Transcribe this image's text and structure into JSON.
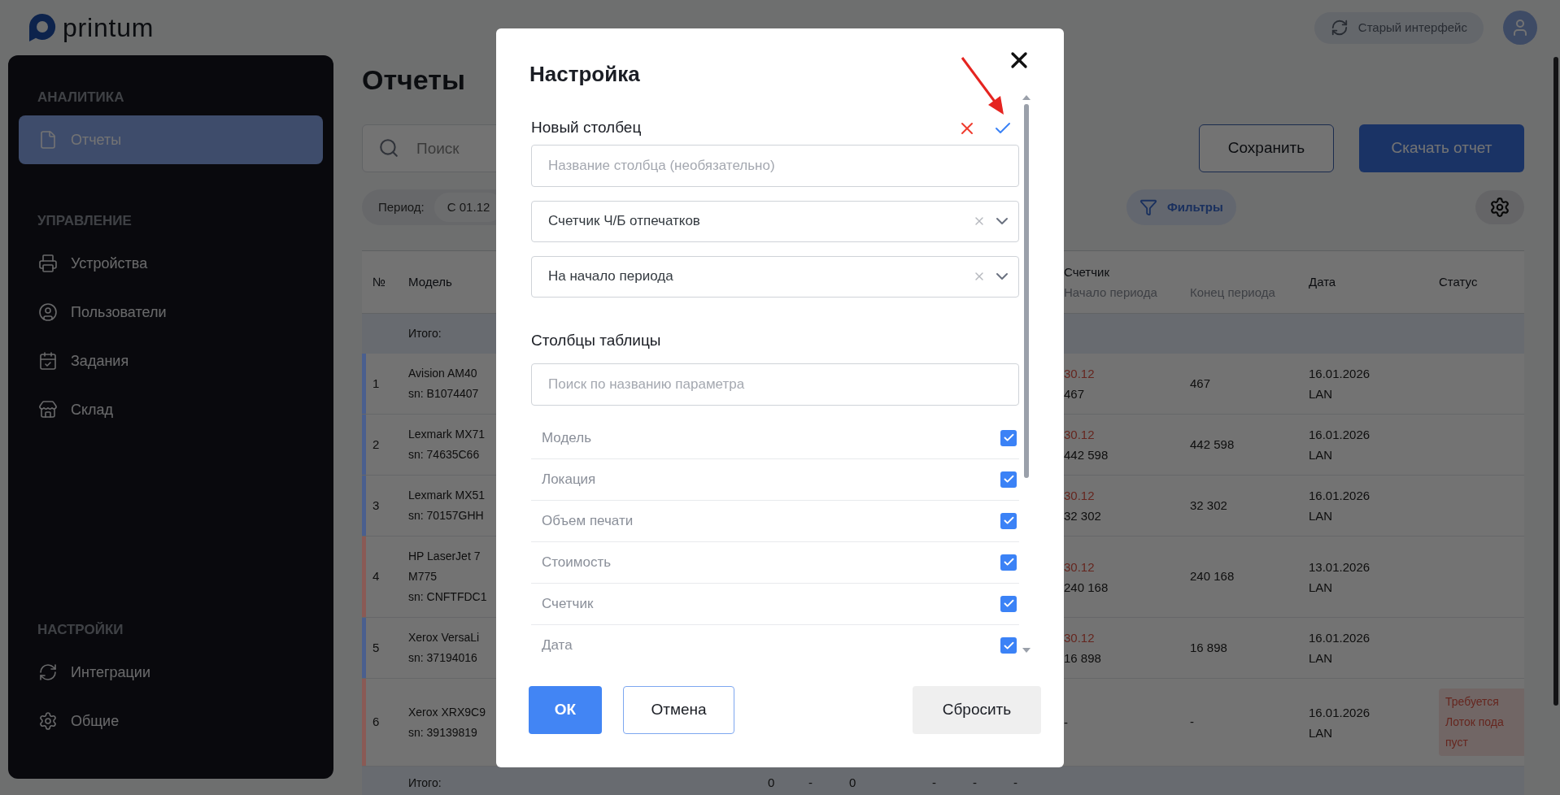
{
  "header": {
    "logo_text": "printum",
    "old_ui_button": "Старый интерфейс"
  },
  "sidebar": {
    "sections": [
      {
        "title": "АНАЛИТИКА",
        "items": [
          {
            "label": "Отчеты",
            "selected": true
          }
        ]
      },
      {
        "title": "УПРАВЛЕНИЕ",
        "items": [
          {
            "label": "Устройства",
            "selected": false
          },
          {
            "label": "Пользователи",
            "selected": false
          },
          {
            "label": "Задания",
            "selected": false
          },
          {
            "label": "Склад",
            "selected": false
          }
        ]
      },
      {
        "title": "НАСТРОЙКИ",
        "items": [
          {
            "label": "Интеграции",
            "selected": false
          },
          {
            "label": "Общие",
            "selected": false
          }
        ]
      }
    ]
  },
  "page": {
    "title": "Отчеты",
    "search": {
      "placeholder": "Поиск"
    },
    "save_button": "Сохранить",
    "download_button": "Скачать отчет",
    "period": {
      "label": "Период:",
      "value": "С 01.12"
    },
    "filters_button": "Фильтры"
  },
  "table": {
    "columns": {
      "number": "№",
      "model": "Модель",
      "counter": "Счетчик",
      "counter_start": "Начало периода",
      "counter_end": "Конец периода",
      "date": "Дата",
      "status": "Статус"
    },
    "total_label": "Итого:",
    "rows": [
      {
        "number": "1",
        "model": [
          "Avision AM40"
        ],
        "serial": "sn: B1074407",
        "color": "#4a5f8e",
        "start_date": "30.12",
        "counter_start": "467",
        "counter_end": "467",
        "date": "16.01.2026",
        "connection": "LAN"
      },
      {
        "number": "2",
        "model": [
          "Lexmark MX71"
        ],
        "serial": "sn: 74635C66",
        "color": "#4a5f8e",
        "start_date": "30.12",
        "counter_start": "442 598",
        "counter_end": "442 598",
        "date": "16.01.2026",
        "connection": "LAN"
      },
      {
        "number": "3",
        "model": [
          "Lexmark MX51"
        ],
        "serial": "sn: 70157GHH",
        "color": "#4a5f8e",
        "start_date": "30.12",
        "counter_start": "32 302",
        "counter_end": "32 302",
        "date": "16.01.2026",
        "connection": "LAN"
      },
      {
        "number": "4",
        "model": [
          "HP LaserJet 7",
          "M775"
        ],
        "serial": "sn: CNFTFDC1",
        "color": "#8a5a55",
        "start_date": "30.12",
        "counter_start": "240 168",
        "counter_end": "240 168",
        "date": "13.01.2026",
        "connection": "LAN"
      },
      {
        "number": "5",
        "model": [
          "Xerox VersaLi"
        ],
        "serial": "sn: 37194016",
        "color": "#4a5f8e",
        "start_date": "30.12",
        "counter_start": "16 898",
        "counter_end": "16 898",
        "date": "16.01.2026",
        "connection": "LAN"
      },
      {
        "number": "6",
        "model": [
          "Xerox XRX9C9"
        ],
        "serial": "sn: 39139819",
        "color": "#8a5a55",
        "counter_start": "-",
        "counter_end": "-",
        "date": "16.01.2026",
        "connection": "LAN",
        "status": [
          "Требуется",
          "Лоток пода",
          "пуст"
        ]
      }
    ],
    "footer": {
      "label": "Итого:",
      "totals": [
        "0",
        "-",
        "0",
        "-",
        "-",
        "-"
      ]
    }
  },
  "modal": {
    "title": "Настройка",
    "new_column": {
      "label": "Новый столбец",
      "name_placeholder": "Название столбца (необязательно)",
      "parameter": "Счетчик Ч/Б отпечатков",
      "period": "На начало периода"
    },
    "columns_title": "Столбцы таблицы",
    "columns_search_placeholder": "Поиск по названию параметра",
    "columns": [
      {
        "label": "Модель",
        "checked": true
      },
      {
        "label": "Локация",
        "checked": true
      },
      {
        "label": "Объем печати",
        "checked": true
      },
      {
        "label": "Стоимость",
        "checked": true
      },
      {
        "label": "Счетчик",
        "checked": true
      },
      {
        "label": "Дата",
        "checked": true
      }
    ],
    "ok_button": "ОК",
    "cancel_button": "Отмена",
    "reset_button": "Сбросить"
  }
}
